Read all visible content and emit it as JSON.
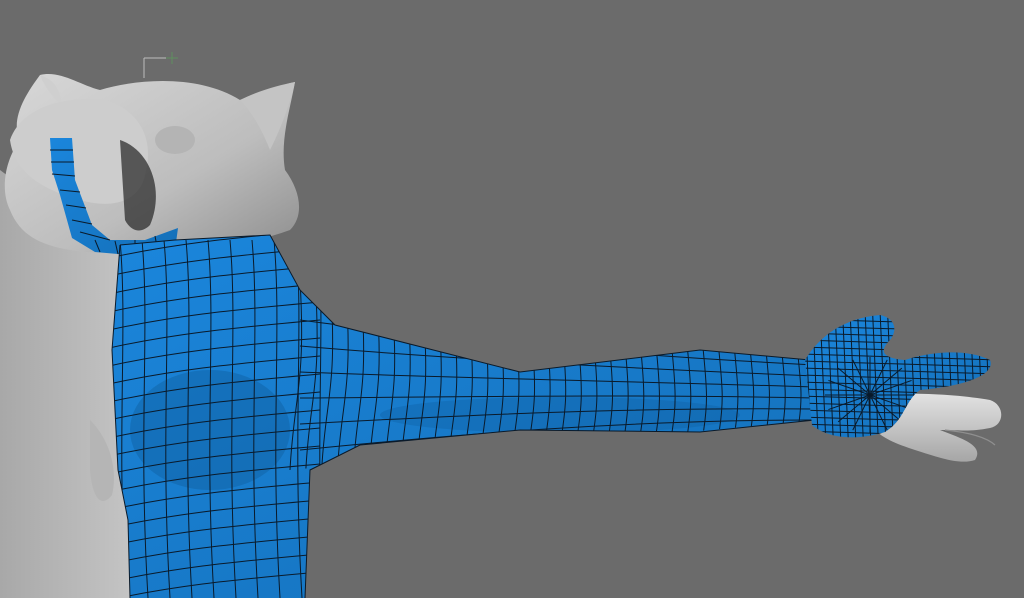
{
  "viewport": {
    "background_color": "#6b6b6b",
    "surface_color": "#c9c9c9",
    "surface_shadow_color": "#9a9a9a",
    "selection_color": "#1a7fd4",
    "wireframe_color": "#0a1a2a",
    "manipulator_icon": "pivot-crosshair-icon"
  }
}
